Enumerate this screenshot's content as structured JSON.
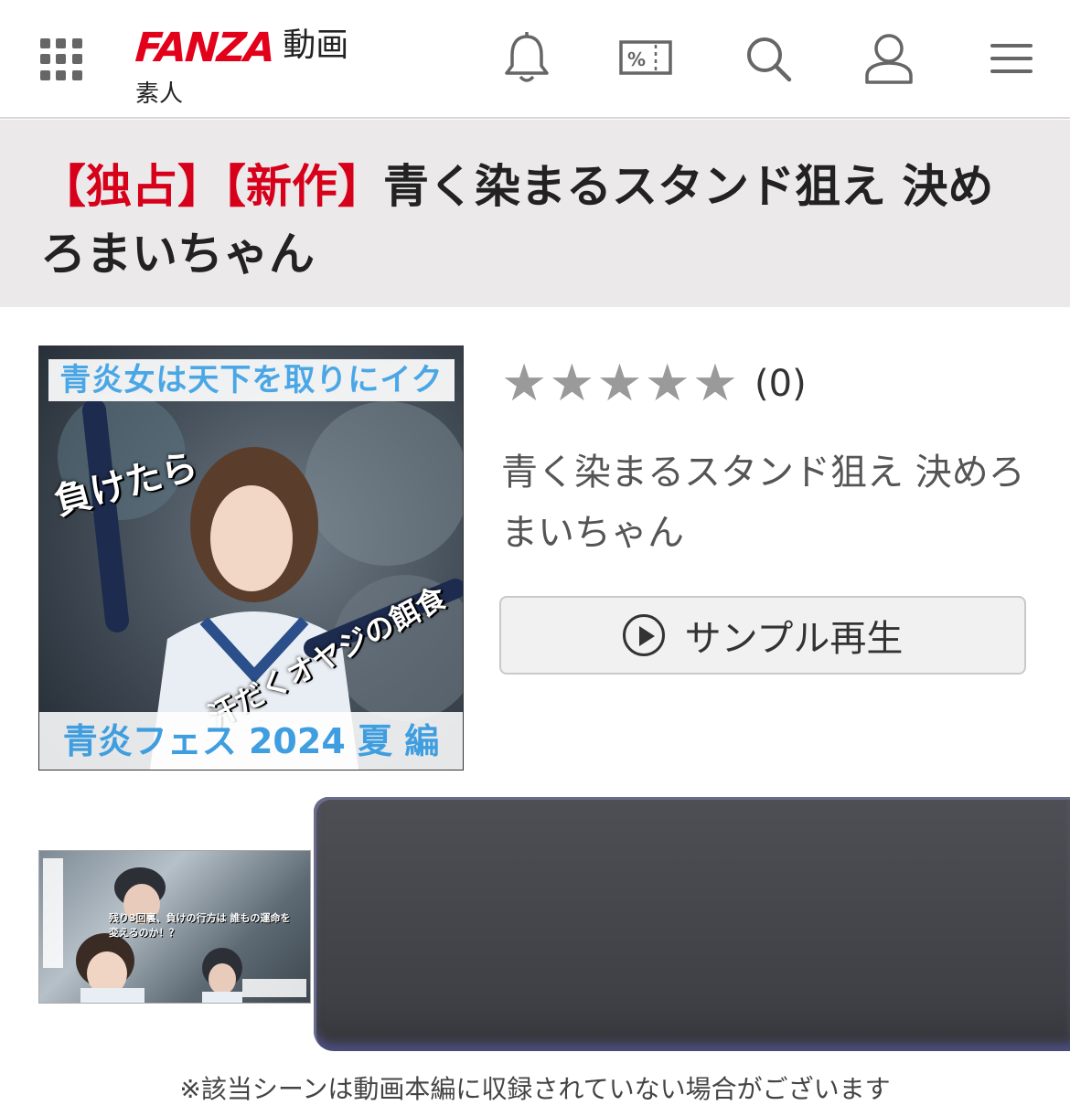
{
  "header": {
    "logo_brand": "FANZA",
    "logo_service": "動画",
    "section_label": "素人",
    "icons": [
      "grid-menu-icon",
      "bell-icon",
      "coupon-icon",
      "search-icon",
      "user-icon",
      "hamburger-menu-icon"
    ],
    "coupon_symbol": "%"
  },
  "title": {
    "tag_exclusive": "【独占】",
    "tag_new": "【新作】",
    "text": "青く染まるスタンド狙え 決めろまいちゃん",
    "tag_color": "#d7001b"
  },
  "cover": {
    "top_banner": "青炎女は天下を取りにイク",
    "side_text": "負けたら",
    "bait_text": "汗だくオヤジの餌食",
    "bottom_banner": "青炎フェス 2024 夏 編"
  },
  "rating": {
    "stars_total": 5,
    "stars_filled": 0,
    "count": "(0)",
    "star_color": "#9a9a9a"
  },
  "subtitle": "青く染まるスタンド狙え 決めろまいちゃん",
  "sample_button": {
    "label": "サンプル再生",
    "icon": "play-circle-icon"
  },
  "thumbnail": {
    "caption": "残り3回裏、負けの行方は 誰もの運命を変えるのか！？"
  },
  "notice": "※該当シーンは動画本編に収録されていない場合がございます",
  "colors": {
    "brand_red": "#e3001b",
    "title_band_bg": "#ebe9ea"
  }
}
